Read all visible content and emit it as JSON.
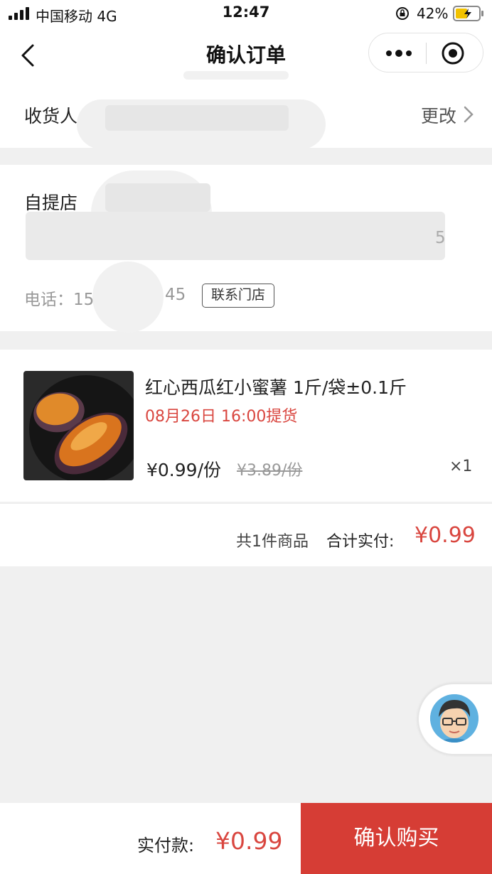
{
  "status_bar": {
    "carrier": "中国移动  4G",
    "time": "12:47",
    "battery": "42%"
  },
  "nav": {
    "title": "确认订单"
  },
  "receiver": {
    "label": "收货人",
    "change_label": "更改"
  },
  "store": {
    "label": "自提店",
    "address_tail": "5",
    "phone_label": "电话：15",
    "phone_tail": "45",
    "contact_button": "联系门店"
  },
  "product": {
    "name": "红心西瓜红小蜜薯 1斤/袋±0.1斤",
    "pickup": "08月26日 16:00提货",
    "price": "¥0.99/份",
    "original_price": "¥3.89/份",
    "quantity": "×1"
  },
  "summary": {
    "item_count": "共1件商品",
    "total_label": "合计实付:",
    "total_value": "¥0.99"
  },
  "footer": {
    "pay_label": "实付款:",
    "pay_value": "¥0.99",
    "submit_label": "确认购买"
  },
  "colors": {
    "accent_red": "#d63d35",
    "price_red": "#d9463f"
  },
  "icons": [
    "back-icon",
    "more-icon",
    "close-target-icon",
    "chevron-right-icon",
    "lock-icon",
    "battery-icon",
    "signal-icon"
  ]
}
